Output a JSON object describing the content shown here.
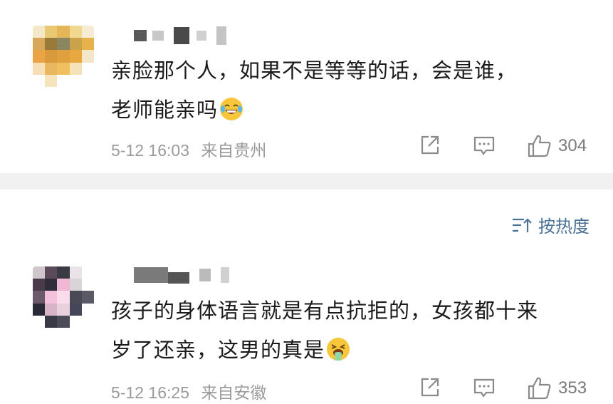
{
  "comments": [
    {
      "text_line1": "亲脸那个人，如果不是等等的话，会是谁，",
      "text_line2": "老师能亲吗",
      "time": "5-12 16:03",
      "location": "来自贵州",
      "likes": "304",
      "emoji": "laughing-tears-emoji"
    },
    {
      "text_line1": "孩子的身体语言就是有点抗拒的，女孩都十来",
      "text_line2": "岁了还亲，这男的真是",
      "time": "5-12 16:25",
      "location": "来自安徽",
      "likes": "353",
      "emoji": "vomiting-emoji"
    }
  ],
  "sort": {
    "label": "按热度"
  },
  "colors": {
    "link": "#4a7296",
    "meta": "#9a9a9a",
    "divider": "#f1f1f1"
  }
}
